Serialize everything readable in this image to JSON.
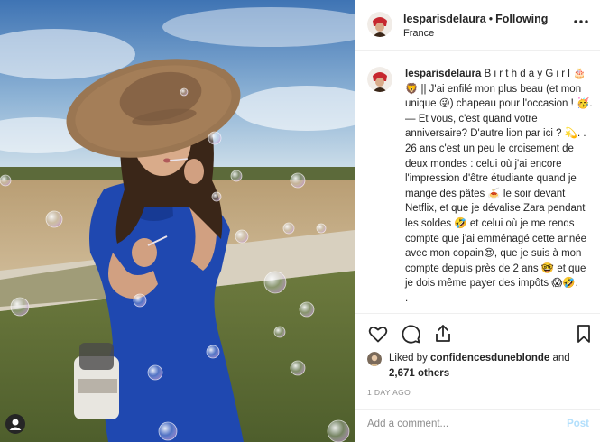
{
  "post": {
    "username": "lesparisdelaura",
    "separator": "•",
    "follow_status": "Following",
    "location": "France",
    "more_icon": "more-dots-icon",
    "caption_lines": [
      "B i r t h d a y G i r l 🎂",
      "🦁 || J'ai enfilé mon plus beau (et mon unique 😜) chapeau pour l'occasion ! 🥳.",
      "— Et vous, c'est quand votre anniversaire? D'autre lion par ici ? 💫. . 26 ans c'est un peu le croisement de deux mondes : celui où j'ai encore l'impression d'être étudiante quand je mange des pâtes 🍝 le soir devant Netflix, et que je dévalise Zara pendant les soldes 🤣 et celui où je me rends compte que j'ai emménagé cette année avec mon copain😍, que je suis à mon compte depuis près de 2 ans 🤓 et que je dois même payer des impôts 😱🤣.",
      "."
    ],
    "liked_by_prefix": "Liked by",
    "liked_by_user": "confidencesduneblonde",
    "liked_and": "and",
    "likes_count": "2,671 others",
    "date": "1 DAY AGO",
    "comment_placeholder": "Add a comment...",
    "post_label": "Post",
    "post_label_color": "#b2dffc",
    "icons": [
      "heart-icon",
      "comment-icon",
      "share-icon",
      "bookmark-icon"
    ]
  }
}
